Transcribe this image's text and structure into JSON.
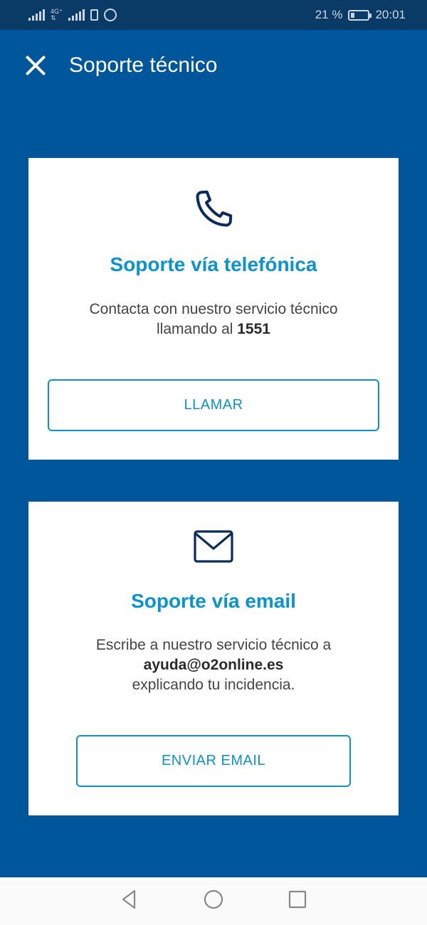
{
  "status_bar": {
    "battery": "21 %",
    "battery_level": 0.21,
    "time": "20:01"
  },
  "header": {
    "title": "Soporte técnico"
  },
  "phone_card": {
    "icon": "phone-icon",
    "title": "Soporte vía telefónica",
    "text_line1": "Contacta con nuestro servicio técnico",
    "text_line2_prefix": "llamando al ",
    "number": "1551",
    "button_label": "LLAMAR"
  },
  "email_card": {
    "icon": "envelope-icon",
    "title": "Soporte vía email",
    "text_line1": "Escribe a nuestro servicio técnico a",
    "email": "ayuda@o2online.es",
    "text_line3": "explicando tu incidencia.",
    "button_label": "ENVIAR EMAIL"
  },
  "colors": {
    "background": "#00569a",
    "accent": "#0b93cf",
    "icon": "#0b2a5e"
  },
  "nav": {
    "back": "back-icon",
    "home": "home-icon",
    "recents": "recents-icon"
  }
}
